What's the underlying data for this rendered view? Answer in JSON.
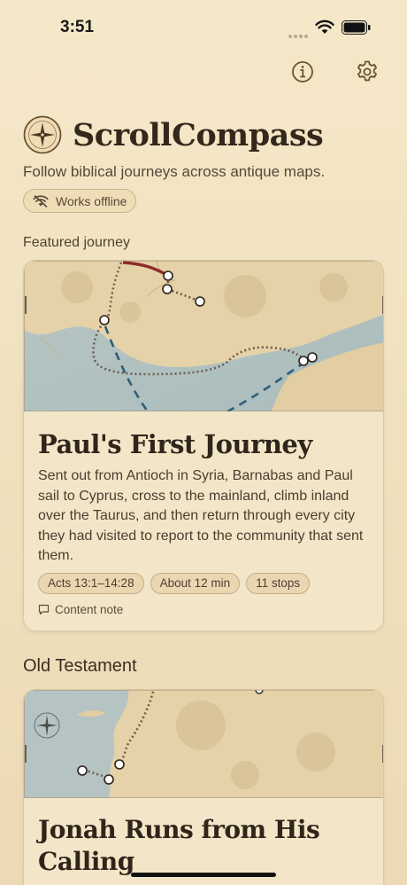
{
  "status": {
    "time": "3:51"
  },
  "top_actions": {
    "info_icon": "info-icon",
    "settings_icon": "gear-icon"
  },
  "brand": {
    "title": "ScrollCompass",
    "tagline": "Follow biblical journeys across antique maps.",
    "offline_badge": "Works offline",
    "logo_icon": "compass-icon"
  },
  "featured": {
    "heading": "Featured journey",
    "title": "Paul's First Journey",
    "description": "Sent out from Antioch in Syria, Barnabas and Paul sail to Cyprus, cross to the mainland, climb inland over the Taurus, and then return through every city they had visited to report to the community that sent them.",
    "chips": [
      "Acts 13:1–14:28",
      "About 12 min",
      "11 stops"
    ],
    "content_note": "Content note"
  },
  "old_testament": {
    "heading": "Old Testament",
    "title": "Jonah Runs from His Calling"
  },
  "colors": {
    "background": "#f2e3c2",
    "accent": "#6b5232",
    "route_sea": "#2f5e78",
    "route_land": "#6e5d4e",
    "route_red": "#8e2b2b"
  }
}
